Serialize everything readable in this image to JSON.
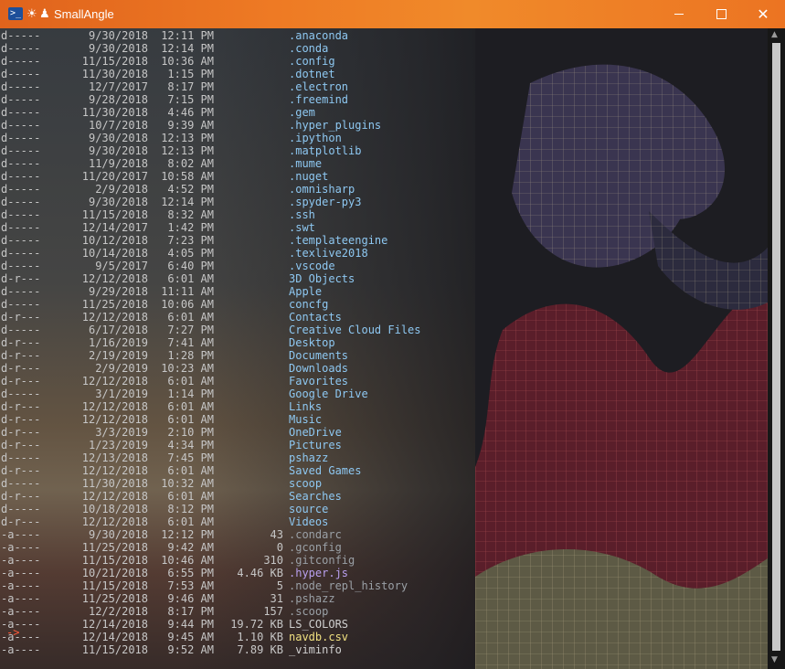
{
  "window": {
    "title": "SmallAngle",
    "ps_glyph": ">_",
    "glyph1": "☀",
    "glyph2": "♟",
    "close_glyph": "✕"
  },
  "scrollbar": {
    "up": "▲",
    "down": "▼"
  },
  "prompt": "->",
  "colors": {
    "accent_orange": "#ee7a24",
    "prompt": "#ff5a3a",
    "dir": "#8ec8f2",
    "hidden_file": "#9aa0a6"
  },
  "entries": [
    {
      "mode": "d-----",
      "date": "9/30/2018",
      "time": "12:11 PM",
      "len": "",
      "name": ".anaconda",
      "kind": "dir"
    },
    {
      "mode": "d-----",
      "date": "9/30/2018",
      "time": "12:14 PM",
      "len": "",
      "name": ".conda",
      "kind": "dir"
    },
    {
      "mode": "d-----",
      "date": "11/15/2018",
      "time": "10:36 AM",
      "len": "",
      "name": ".config",
      "kind": "dir"
    },
    {
      "mode": "d-----",
      "date": "11/30/2018",
      "time": "1:15 PM",
      "len": "",
      "name": ".dotnet",
      "kind": "dir"
    },
    {
      "mode": "d-----",
      "date": "12/7/2017",
      "time": "8:17 PM",
      "len": "",
      "name": ".electron",
      "kind": "dir"
    },
    {
      "mode": "d-----",
      "date": "9/28/2018",
      "time": "7:15 PM",
      "len": "",
      "name": ".freemind",
      "kind": "dir"
    },
    {
      "mode": "d-----",
      "date": "11/30/2018",
      "time": "4:46 PM",
      "len": "",
      "name": ".gem",
      "kind": "dir"
    },
    {
      "mode": "d-----",
      "date": "10/7/2018",
      "time": "9:39 AM",
      "len": "",
      "name": ".hyper_plugins",
      "kind": "dir"
    },
    {
      "mode": "d-----",
      "date": "9/30/2018",
      "time": "12:13 PM",
      "len": "",
      "name": ".ipython",
      "kind": "dir"
    },
    {
      "mode": "d-----",
      "date": "9/30/2018",
      "time": "12:13 PM",
      "len": "",
      "name": ".matplotlib",
      "kind": "dir"
    },
    {
      "mode": "d-----",
      "date": "11/9/2018",
      "time": "8:02 AM",
      "len": "",
      "name": ".mume",
      "kind": "dir"
    },
    {
      "mode": "d-----",
      "date": "11/20/2017",
      "time": "10:58 AM",
      "len": "",
      "name": ".nuget",
      "kind": "dir"
    },
    {
      "mode": "d-----",
      "date": "2/9/2018",
      "time": "4:52 PM",
      "len": "",
      "name": ".omnisharp",
      "kind": "dir"
    },
    {
      "mode": "d-----",
      "date": "9/30/2018",
      "time": "12:14 PM",
      "len": "",
      "name": ".spyder-py3",
      "kind": "dir"
    },
    {
      "mode": "d-----",
      "date": "11/15/2018",
      "time": "8:32 AM",
      "len": "",
      "name": ".ssh",
      "kind": "dir"
    },
    {
      "mode": "d-----",
      "date": "12/14/2017",
      "time": "1:42 PM",
      "len": "",
      "name": ".swt",
      "kind": "dir"
    },
    {
      "mode": "d-----",
      "date": "10/12/2018",
      "time": "7:23 PM",
      "len": "",
      "name": ".templateengine",
      "kind": "dir"
    },
    {
      "mode": "d-----",
      "date": "10/14/2018",
      "time": "4:05 PM",
      "len": "",
      "name": ".texlive2018",
      "kind": "dir"
    },
    {
      "mode": "d-----",
      "date": "9/5/2017",
      "time": "6:40 PM",
      "len": "",
      "name": ".vscode",
      "kind": "dir"
    },
    {
      "mode": "d-r---",
      "date": "12/12/2018",
      "time": "6:01 AM",
      "len": "",
      "name": "3D Objects",
      "kind": "dir"
    },
    {
      "mode": "d-----",
      "date": "9/29/2018",
      "time": "11:11 AM",
      "len": "",
      "name": "Apple",
      "kind": "dir"
    },
    {
      "mode": "d-----",
      "date": "11/25/2018",
      "time": "10:06 AM",
      "len": "",
      "name": "concfg",
      "kind": "dir"
    },
    {
      "mode": "d-r---",
      "date": "12/12/2018",
      "time": "6:01 AM",
      "len": "",
      "name": "Contacts",
      "kind": "dir"
    },
    {
      "mode": "d-----",
      "date": "6/17/2018",
      "time": "7:27 PM",
      "len": "",
      "name": "Creative Cloud Files",
      "kind": "dir"
    },
    {
      "mode": "d-r---",
      "date": "1/16/2019",
      "time": "7:41 AM",
      "len": "",
      "name": "Desktop",
      "kind": "dir"
    },
    {
      "mode": "d-r---",
      "date": "2/19/2019",
      "time": "1:28 PM",
      "len": "",
      "name": "Documents",
      "kind": "dir"
    },
    {
      "mode": "d-r---",
      "date": "2/9/2019",
      "time": "10:23 AM",
      "len": "",
      "name": "Downloads",
      "kind": "dir"
    },
    {
      "mode": "d-r---",
      "date": "12/12/2018",
      "time": "6:01 AM",
      "len": "",
      "name": "Favorites",
      "kind": "dir"
    },
    {
      "mode": "d-----",
      "date": "3/1/2019",
      "time": "1:14 PM",
      "len": "",
      "name": "Google Drive",
      "kind": "dir"
    },
    {
      "mode": "d-r---",
      "date": "12/12/2018",
      "time": "6:01 AM",
      "len": "",
      "name": "Links",
      "kind": "dir"
    },
    {
      "mode": "d-r---",
      "date": "12/12/2018",
      "time": "6:01 AM",
      "len": "",
      "name": "Music",
      "kind": "dir"
    },
    {
      "mode": "d-r---",
      "date": "3/3/2019",
      "time": "2:10 PM",
      "len": "",
      "name": "OneDrive",
      "kind": "dir"
    },
    {
      "mode": "d-r---",
      "date": "1/23/2019",
      "time": "4:34 PM",
      "len": "",
      "name": "Pictures",
      "kind": "dir"
    },
    {
      "mode": "d-----",
      "date": "12/13/2018",
      "time": "7:45 PM",
      "len": "",
      "name": "pshazz",
      "kind": "dir"
    },
    {
      "mode": "d-r---",
      "date": "12/12/2018",
      "time": "6:01 AM",
      "len": "",
      "name": "Saved Games",
      "kind": "dir"
    },
    {
      "mode": "d-----",
      "date": "11/30/2018",
      "time": "10:32 AM",
      "len": "",
      "name": "scoop",
      "kind": "dir"
    },
    {
      "mode": "d-r---",
      "date": "12/12/2018",
      "time": "6:01 AM",
      "len": "",
      "name": "Searches",
      "kind": "dir"
    },
    {
      "mode": "d-----",
      "date": "10/18/2018",
      "time": "8:12 PM",
      "len": "",
      "name": "source",
      "kind": "dir"
    },
    {
      "mode": "d-r---",
      "date": "12/12/2018",
      "time": "6:01 AM",
      "len": "",
      "name": "Videos",
      "kind": "dir"
    },
    {
      "mode": "-a----",
      "date": "9/30/2018",
      "time": "12:12 PM",
      "len": "43",
      "name": ".condarc",
      "kind": "hid"
    },
    {
      "mode": "-a----",
      "date": "11/25/2018",
      "time": "9:42 AM",
      "len": "0",
      "name": ".gconfig",
      "kind": "hid"
    },
    {
      "mode": "-a----",
      "date": "11/15/2018",
      "time": "10:46 AM",
      "len": "310",
      "name": ".gitconfig",
      "kind": "hid"
    },
    {
      "mode": "-a----",
      "date": "10/21/2018",
      "time": "6:55 PM",
      "len": "4.46 KB",
      "name": ".hyper.js",
      "kind": "hidjs"
    },
    {
      "mode": "-a----",
      "date": "11/15/2018",
      "time": "7:53 AM",
      "len": "5",
      "name": ".node_repl_history",
      "kind": "hid"
    },
    {
      "mode": "-a----",
      "date": "11/25/2018",
      "time": "9:46 AM",
      "len": "31",
      "name": ".pshazz",
      "kind": "hid"
    },
    {
      "mode": "-a----",
      "date": "12/2/2018",
      "time": "8:17 PM",
      "len": "157",
      "name": ".scoop",
      "kind": "hid"
    },
    {
      "mode": "-a----",
      "date": "12/14/2018",
      "time": "9:44 PM",
      "len": "19.72 KB",
      "name": "LS_COLORS",
      "kind": "plain"
    },
    {
      "mode": "-a----",
      "date": "12/14/2018",
      "time": "9:45 AM",
      "len": "1.10 KB",
      "name": "navdb.csv",
      "kind": "csv"
    },
    {
      "mode": "-a----",
      "date": "11/15/2018",
      "time": "9:52 AM",
      "len": "7.89 KB",
      "name": "_viminfo",
      "kind": "plain"
    }
  ]
}
